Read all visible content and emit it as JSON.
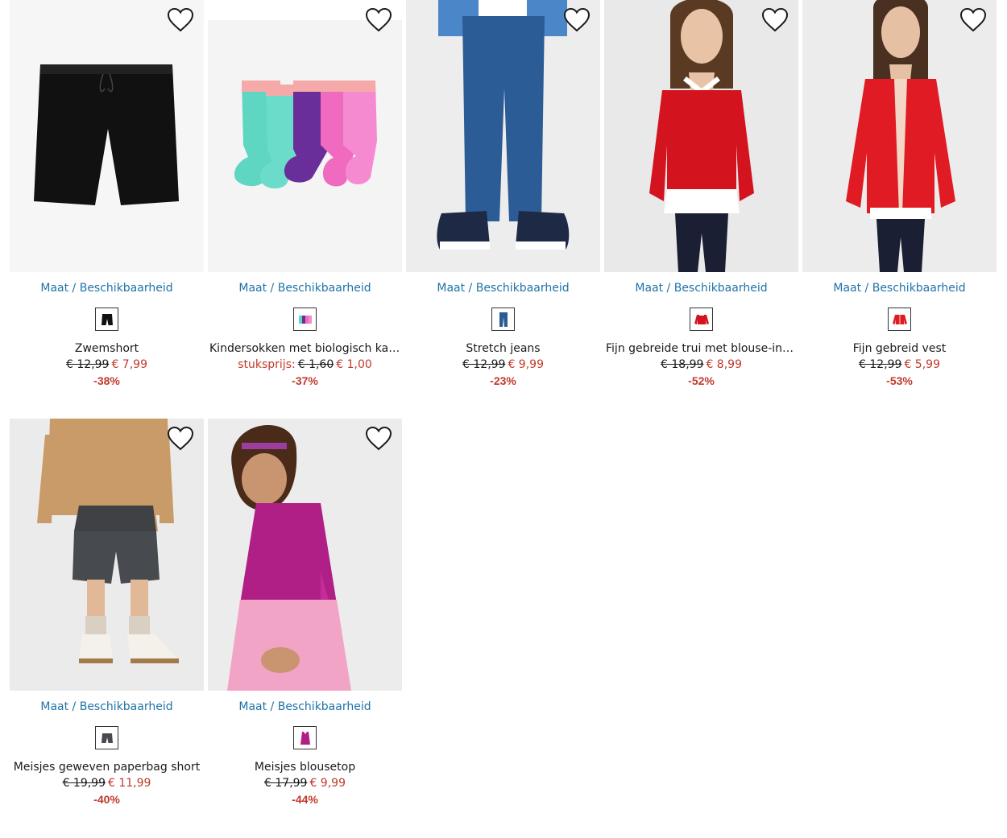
{
  "availability_label": "Maat / Beschikbaarheid",
  "products": [
    {
      "title": "Zwemshort",
      "unit_label": "",
      "old_price": "€ 12,99",
      "new_price": "€ 7,99",
      "discount": "-38%",
      "favorite_icon": "heart-outline-icon",
      "swatch_icon": "black-shorts-icon"
    },
    {
      "title": "Kindersokken met biologisch katoe…",
      "unit_label": "stuksprijs:",
      "old_price": "€ 1,60",
      "new_price": "€ 1,00",
      "discount": "-37%",
      "favorite_icon": "heart-outline-icon",
      "swatch_icon": "multicolor-socks-icon"
    },
    {
      "title": "Stretch jeans",
      "unit_label": "",
      "old_price": "€ 12,99",
      "new_price": "€ 9,99",
      "discount": "-23%",
      "favorite_icon": "heart-outline-icon",
      "swatch_icon": "blue-jeans-icon"
    },
    {
      "title": "Fijn gebreide trui met blouse-inzet",
      "unit_label": "",
      "old_price": "€ 18,99",
      "new_price": "€ 8,99",
      "discount": "-52%",
      "favorite_icon": "heart-outline-icon",
      "swatch_icon": "red-sweater-icon"
    },
    {
      "title": "Fijn gebreid vest",
      "unit_label": "",
      "old_price": "€ 12,99",
      "new_price": "€ 5,99",
      "discount": "-53%",
      "favorite_icon": "heart-outline-icon",
      "swatch_icon": "red-cardigan-icon"
    },
    {
      "title": "Meisjes geweven paperbag short",
      "unit_label": "",
      "old_price": "€ 19,99",
      "new_price": "€ 11,99",
      "discount": "-40%",
      "favorite_icon": "heart-outline-icon",
      "swatch_icon": "grey-shorts-icon"
    },
    {
      "title": "Meisjes blousetop",
      "unit_label": "",
      "old_price": "€ 17,99",
      "new_price": "€ 9,99",
      "discount": "-44%",
      "favorite_icon": "heart-outline-icon",
      "swatch_icon": "magenta-top-icon"
    }
  ],
  "colors": {
    "link": "#1f73a8",
    "sale": "#c0392b",
    "text": "#1a1a1a"
  }
}
